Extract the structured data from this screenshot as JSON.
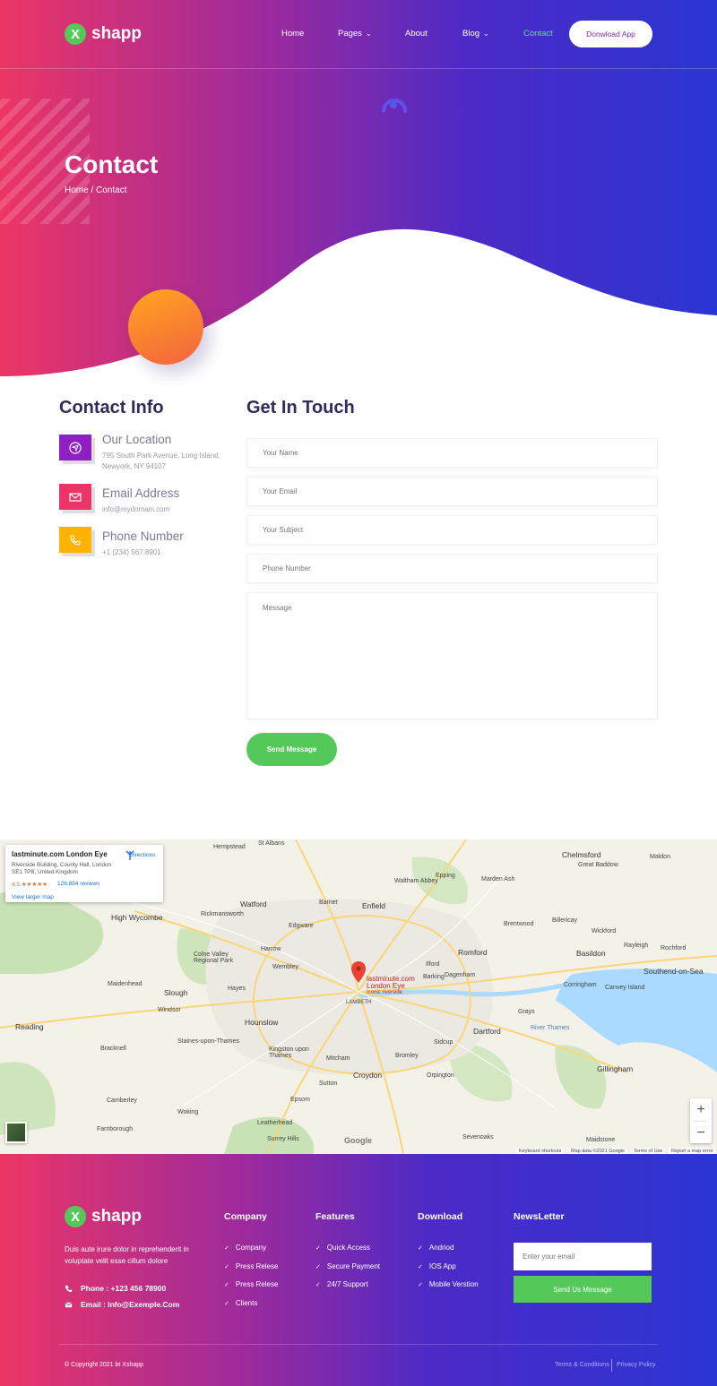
{
  "brand": {
    "logo_letter": "X",
    "name": "shapp"
  },
  "nav": {
    "items": [
      {
        "label": "Home"
      },
      {
        "label": "Pages"
      },
      {
        "label": "About"
      },
      {
        "label": "Blog"
      },
      {
        "label": "Contact",
        "active": true
      }
    ],
    "cta": "Donwload App"
  },
  "hero": {
    "title": "Contact",
    "breadcrumb_home": "Home",
    "breadcrumb_sep": "/",
    "breadcrumb_current": "Contact"
  },
  "contact_info": {
    "title": "Contact Info",
    "items": [
      {
        "icon": "location-icon",
        "color": "#8e1fc2",
        "title": "Our Location",
        "text": "795 South Park Avenue, Long Island, Newyork, NY 94107"
      },
      {
        "icon": "mail-icon",
        "color": "#ec3566",
        "title": "Email Address",
        "text": "info@mydomain.com"
      },
      {
        "icon": "phone-icon",
        "color": "#ffb300",
        "title": "Phone Number",
        "text": "+1 (234) 567 8901"
      }
    ]
  },
  "form": {
    "title": "Get In Touch",
    "name_placeholder": "Your Name",
    "email_placeholder": "Your Email",
    "subject_placeholder": "Your Subject",
    "phone_placeholder": "Phone Number",
    "message_placeholder": "Message",
    "submit": "Send Message"
  },
  "map": {
    "place_name": "lastminute.com London Eye",
    "address": "Riverside Building, County Hall, London SE1 7PB, United Kingdom",
    "rating": "4.5 ★★★★★",
    "reviews": "126,894 reviews",
    "view_larger": "View larger map",
    "directions": "Directions",
    "pin_title": "lastminute.com London Eye",
    "pin_sub": "Iconic riverside",
    "labels": {
      "st_albans": "St Albans",
      "hempstead": "Hempstead",
      "chelmsford": "Chelmsford",
      "great_baddow": "Great Baddow",
      "maldon": "Maldon",
      "watford": "Watford",
      "barnet": "Barnet",
      "enfield": "Enfield",
      "waltham_abbey": "Waltham Abbey",
      "epping": "Epping",
      "marden_ash": "Marden Ash",
      "high_wycombe": "High Wycombe",
      "brentwood": "Brentwood",
      "billericay": "Billericay",
      "wickford": "Wickford",
      "edgware": "Edgware",
      "harrow": "Harrow",
      "romford": "Romford",
      "basildon": "Basildon",
      "rayleigh": "Rayleigh",
      "rochford": "Rochford",
      "wembley": "Wembley",
      "southend": "Southend-on-Sea",
      "maidenhead": "Maidenhead",
      "slough": "Slough",
      "hayes": "Hayes",
      "ilford": "Ilford",
      "barking": "Barking",
      "dagenham": "Dagenham",
      "corringham": "Corringham",
      "canvey": "Canvey Island",
      "reading": "Reading",
      "hounslow": "Hounslow",
      "lambeth": "LAMBETH",
      "bracknell": "Bracknell",
      "dartford": "Dartford",
      "grays": "Grays",
      "mitcham": "Mitcham",
      "bromley": "Bromley",
      "sidcup": "Sidcup",
      "gillingham": "Gillingham",
      "croydon": "Croydon",
      "epsom": "Epsom",
      "sutton": "Sutton",
      "woking": "Woking",
      "leatherhead": "Leatherhead",
      "maidstone": "Maidstone",
      "farnborough": "Farnborough",
      "sevenoaks": "Sevenoaks",
      "surrey_hills": "Surrey Hills",
      "camberley": "Camberley",
      "orpington": "Orpington",
      "windsor": "Windsor",
      "staines": "Staines-upon-Thames",
      "kingston": "Kingston upon Thames",
      "colne_valley": "Colne Valley Regional Park",
      "rickmansworth": "Rickmansworth",
      "river_thames": "River Thames"
    },
    "google": "Google",
    "attr_shortcuts": "Keyboard shortcuts",
    "attr_data": "Map data ©2021 Google",
    "attr_terms": "Terms of Use",
    "attr_report": "Report a map error"
  },
  "footer": {
    "about": "Duis aute irure dolor in reprehenderit in voluptate velit esse cillum dolore",
    "phone": "Phone : +123 456 78900",
    "email": "Email : Info@Exemple.Com",
    "columns": [
      {
        "title": "Company",
        "links": [
          "Company",
          "Press Relese",
          "Press Relese",
          "Clients"
        ]
      },
      {
        "title": "Features",
        "links": [
          "Quick Access",
          "Secure Payment",
          "24/7 Support"
        ]
      },
      {
        "title": "Download",
        "links": [
          "Andriod",
          "IOS App",
          "Mobile Verstion"
        ]
      }
    ],
    "newsletter_title": "NewsLetter",
    "newsletter_placeholder": "Enter your email",
    "newsletter_button": "Send Us Message",
    "copyright": "© Copyright 2021 bt Xshapp",
    "terms": "Terms & Conditions",
    "privacy": "Privacy Policy"
  },
  "colors": {
    "accent_green": "#55c85a",
    "title_navy": "#2f2b5e",
    "gradient_pink": "#ec3566",
    "gradient_blue": "#2a35d4"
  }
}
